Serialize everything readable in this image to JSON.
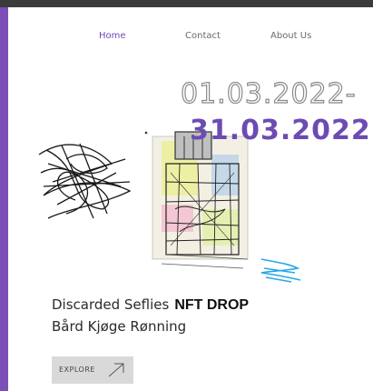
{
  "nav": {
    "items": [
      "Home",
      "Contact",
      "About Us"
    ],
    "active": "Home"
  },
  "event": {
    "start_date": "01.03.2022-",
    "end_date": "31.03.2022"
  },
  "project": {
    "title": "Discarded Seflies",
    "tag": "NFT DROP",
    "artist": "Bård Kjøge Rønning"
  },
  "cta": {
    "label": "EXPLORE"
  },
  "icons": {
    "cta": "arrow-up-right-icon"
  },
  "colors": {
    "accent": "#6c4bb3",
    "sidebar": "#7b4fb6",
    "button_bg": "#d9d9d9"
  }
}
